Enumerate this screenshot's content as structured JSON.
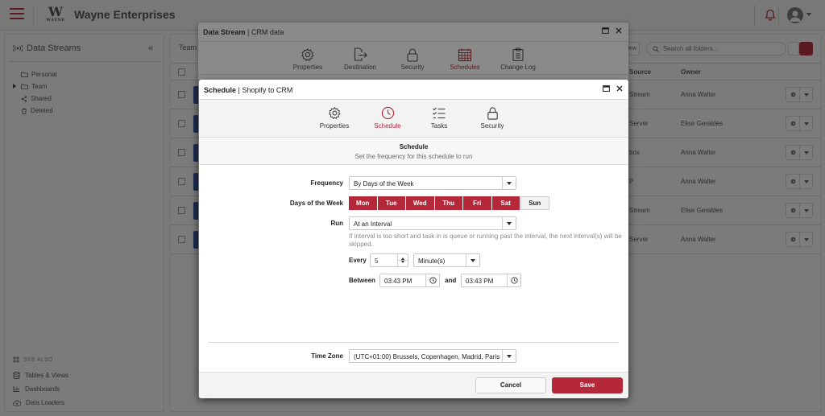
{
  "topbar": {
    "brand": "Wayne Enterprises",
    "logo_letter": "W",
    "logo_sub": "WAYNE"
  },
  "left": {
    "title": "Data Streams",
    "tree": [
      {
        "label": "Personal",
        "icon": "folder-icon",
        "caret": false
      },
      {
        "label": "Team",
        "icon": "folder-icon",
        "caret": true
      },
      {
        "label": "Shared",
        "icon": "share-icon",
        "caret": false
      },
      {
        "label": "Deleted",
        "icon": "trash-icon",
        "caret": false
      }
    ],
    "see_also": "SEE ALSO",
    "links": [
      "Tables & Views",
      "Dashboards",
      "Data Loaders"
    ]
  },
  "main": {
    "tab": "Team",
    "new_label": "New",
    "search_placeholder": "Search all folders...",
    "columns": {
      "source": "Source",
      "owner": "Owner"
    },
    "rows": [
      {
        "source": "Stream",
        "owner": "Anna Walter"
      },
      {
        "source": "Server",
        "owner": "Elise Geraldes"
      },
      {
        "source": "box",
        "owner": "Anna Walter"
      },
      {
        "source": "P",
        "owner": "Anna Walter"
      },
      {
        "source": "Stream",
        "owner": "Elise Geraldes"
      },
      {
        "source": "Server",
        "owner": "Anna Walter"
      }
    ]
  },
  "outer_modal": {
    "title_bold": "Data Stream",
    "title_rest": "CRM data",
    "tabs": [
      "Properties",
      "Destination",
      "Security",
      "Schedules",
      "Change Log"
    ],
    "active_tab": "Schedules"
  },
  "inner_modal": {
    "title_bold": "Schedule",
    "title_rest": "Shopify to CRM",
    "tabs": [
      "Properties",
      "Schedule",
      "Tasks",
      "Security"
    ],
    "active_tab": "Schedule",
    "section_title": "Schedule",
    "section_subtitle": "Set the frequency for this schedule to run",
    "frequency_label": "Frequency",
    "frequency_value": "By Days of the Week",
    "days_label": "Days of the Week",
    "days": [
      {
        "label": "Mon",
        "on": true
      },
      {
        "label": "Tue",
        "on": true
      },
      {
        "label": "Wed",
        "on": true
      },
      {
        "label": "Thu",
        "on": true
      },
      {
        "label": "Fri",
        "on": true
      },
      {
        "label": "Sat",
        "on": true
      },
      {
        "label": "Sun",
        "on": false
      }
    ],
    "run_label": "Run",
    "run_value": "At an Interval",
    "run_hint": "If interval is too short and task in is queue or running past the interval, the next interval(s) will be skipped.",
    "every_label": "Every",
    "every_value": "5",
    "unit_value": "Minute(s)",
    "between_label": "Between",
    "start_time": "03:43 PM",
    "and_label": "and",
    "end_time": "03:43 PM",
    "timezone_label": "Time Zone",
    "timezone_value": "(UTC+01:00) Brussels, Copenhagen, Madrid, Paris",
    "cancel_label": "Cancel",
    "save_label": "Save"
  },
  "colors": {
    "accent": "#b4283a",
    "brand_dark": "#5b1a20"
  }
}
